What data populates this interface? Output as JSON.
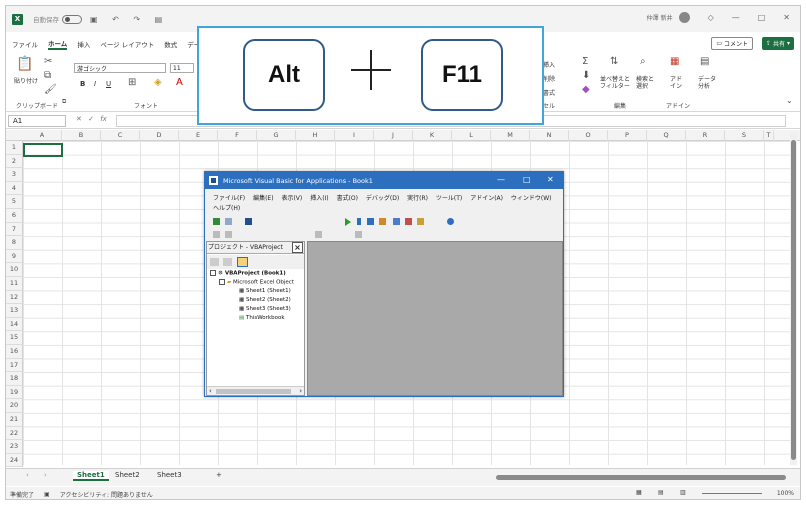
{
  "title_bar": {
    "autosave_label": "自動保存",
    "autosave_state": "オフ",
    "user_name": "仲澤 新井"
  },
  "menu": {
    "items": [
      "ファイル",
      "ホーム",
      "挿入",
      "ページ レイアウト",
      "数式",
      "デー"
    ],
    "active": "ホーム",
    "comment_label": "コメント",
    "share_label": "共有"
  },
  "ribbon": {
    "paste_label": "貼り付け",
    "clipboard_label": "クリップボード",
    "font_label": "フォント",
    "font_name": "游ゴシック",
    "font_size": "11",
    "insert_label": "挿入",
    "delete_label": "削除",
    "format_label": "書式",
    "cells_label": "セル",
    "sort_label": "並べ替えと\nフィルター",
    "find_label": "検索と\n選択",
    "edit_label": "編集",
    "addin_label": "アド\nイン",
    "addin_group_label": "アドイン",
    "data_label": "データ\n分析"
  },
  "formula_bar": {
    "name_box": "A1",
    "fx": "fx"
  },
  "columns": [
    "A",
    "B",
    "C",
    "D",
    "E",
    "F",
    "G",
    "H",
    "I",
    "J",
    "K",
    "L",
    "M",
    "N",
    "O",
    "P",
    "Q",
    "R",
    "S",
    "T"
  ],
  "rows": [
    "1",
    "2",
    "3",
    "4",
    "5",
    "6",
    "7",
    "8",
    "9",
    "10",
    "11",
    "12",
    "13",
    "14",
    "15",
    "16",
    "17",
    "18",
    "19",
    "20",
    "21",
    "22",
    "23",
    "24"
  ],
  "sheets": {
    "tabs": [
      "Sheet1",
      "Sheet2",
      "Sheet3"
    ],
    "active": "Sheet1",
    "add": "+"
  },
  "status_bar": {
    "ready": "準備完了",
    "accessibility": "アクセシビリティ: 問題ありません",
    "zoom": "100%"
  },
  "shortcut": {
    "key1": "Alt",
    "key2": "F11"
  },
  "vba_window": {
    "title": "Microsoft Visual Basic for Applications - Book1",
    "menu": [
      "ファイル(F)",
      "編集(E)",
      "表示(V)",
      "挿入(I)",
      "書式(O)",
      "デバッグ(D)",
      "実行(R)",
      "ツール(T)",
      "アドイン(A)",
      "ウィンドウ(W)",
      "ヘルプ(H)"
    ],
    "project_pane_title": "プロジェクト - VBAProject",
    "tree": [
      "VBAProject (Book1)",
      "Microsoft Excel Object",
      "Sheet1 (Sheet1)",
      "Sheet2 (Sheet2)",
      "Sheet3 (Sheet3)",
      "ThisWorkbook"
    ]
  }
}
